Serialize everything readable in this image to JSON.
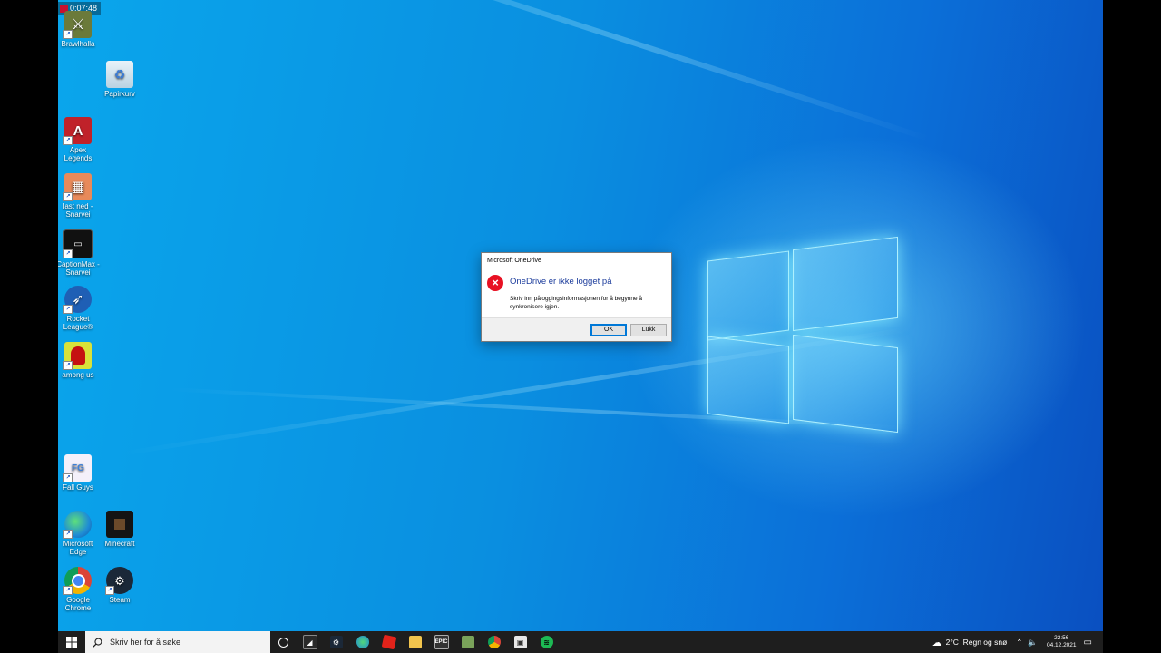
{
  "recorder": {
    "time": "0:07:48"
  },
  "desktop_icons": [
    {
      "label": "Brawlhalla"
    },
    {
      "label": "Papirkurv"
    },
    {
      "label": "Apex Legends"
    },
    {
      "label": "last ned - Snarvei"
    },
    {
      "label": "CaptionMax - Snarvei"
    },
    {
      "label": "Rocket League®"
    },
    {
      "label": "among us"
    },
    {
      "label": "Fall Guys"
    },
    {
      "label": "Microsoft Edge"
    },
    {
      "label": "Minecraft"
    },
    {
      "label": "Google Chrome"
    },
    {
      "label": "Steam"
    }
  ],
  "dialog": {
    "title": "Microsoft OneDrive",
    "heading": "OneDrive er ikke logget på",
    "message": "Skriv inn påloggingsinformasjonen for å begynne å synkronisere igjen.",
    "ok_label": "OK",
    "close_label": "Lukk"
  },
  "taskbar": {
    "search_placeholder": "Skriv her for å søke",
    "apps": [
      "task-view",
      "epic-games",
      "steam",
      "edge",
      "roblox",
      "file-explorer",
      "epic-launcher",
      "minecraft",
      "chrome",
      "store",
      "spotify"
    ],
    "weather": "2°C  Regn og snø",
    "time": "22:56",
    "date": "04.12.2021"
  }
}
